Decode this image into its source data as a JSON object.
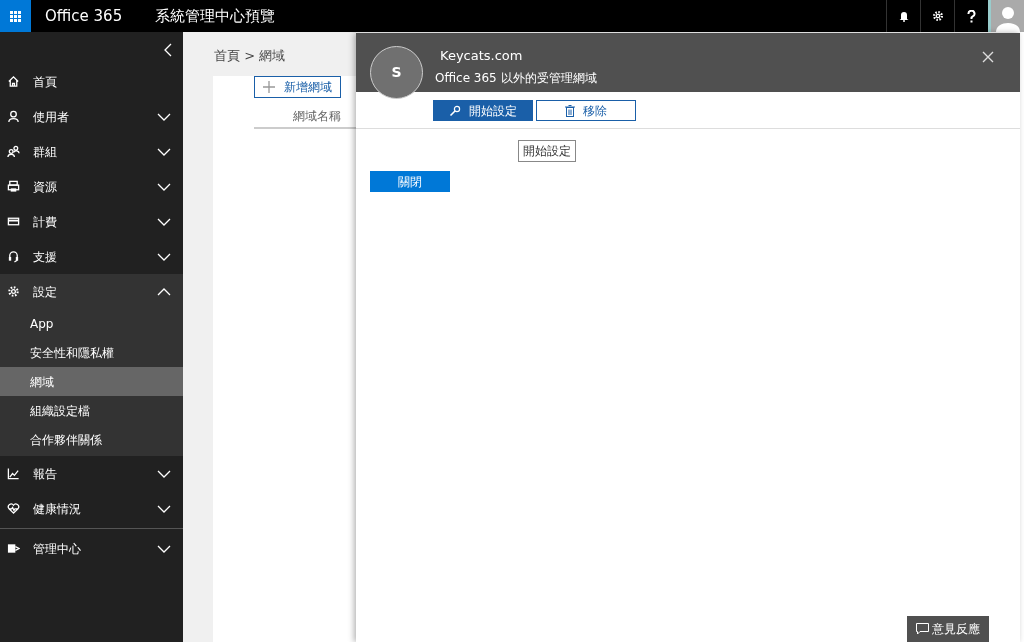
{
  "top_bar": {
    "app_title": "Office 365",
    "page_title": "系統管理中心預覽"
  },
  "sidebar": {
    "items": [
      {
        "kind": "link",
        "label": "首頁"
      },
      {
        "kind": "group",
        "label": "使用者",
        "expanded": false
      },
      {
        "kind": "group",
        "label": "群組",
        "expanded": false
      },
      {
        "kind": "group",
        "label": "資源",
        "expanded": false
      },
      {
        "kind": "group",
        "label": "計費",
        "expanded": false
      },
      {
        "kind": "group",
        "label": "支援",
        "expanded": false
      },
      {
        "kind": "group",
        "label": "設定",
        "expanded": true,
        "children": [
          {
            "label": "App",
            "selected": false
          },
          {
            "label": "安全性和隱私權",
            "selected": false
          },
          {
            "label": "網域",
            "selected": true
          },
          {
            "label": "組織設定檔",
            "selected": false
          },
          {
            "label": "合作夥伴關係",
            "selected": false
          }
        ]
      },
      {
        "kind": "group",
        "label": "報告",
        "expanded": false
      },
      {
        "kind": "group",
        "label": "健康情況",
        "expanded": false
      }
    ],
    "footer_items": [
      {
        "kind": "group",
        "label": "管理中心",
        "expanded": false
      }
    ]
  },
  "main": {
    "breadcrumb": "首頁 > 網域",
    "add_button": "新增網域",
    "table": {
      "columns": [
        "網域名稱"
      ]
    }
  },
  "panel": {
    "avatar_initial": "S",
    "title": "Keycats.com",
    "subtitle": "Office 365 以外的受管理網域",
    "actions": [
      {
        "label": "開始設定",
        "primary": true
      },
      {
        "label": "移除",
        "primary": false
      }
    ],
    "tooltip": "開始設定",
    "close_button": "關閉"
  },
  "feedback_button": "意見反應"
}
